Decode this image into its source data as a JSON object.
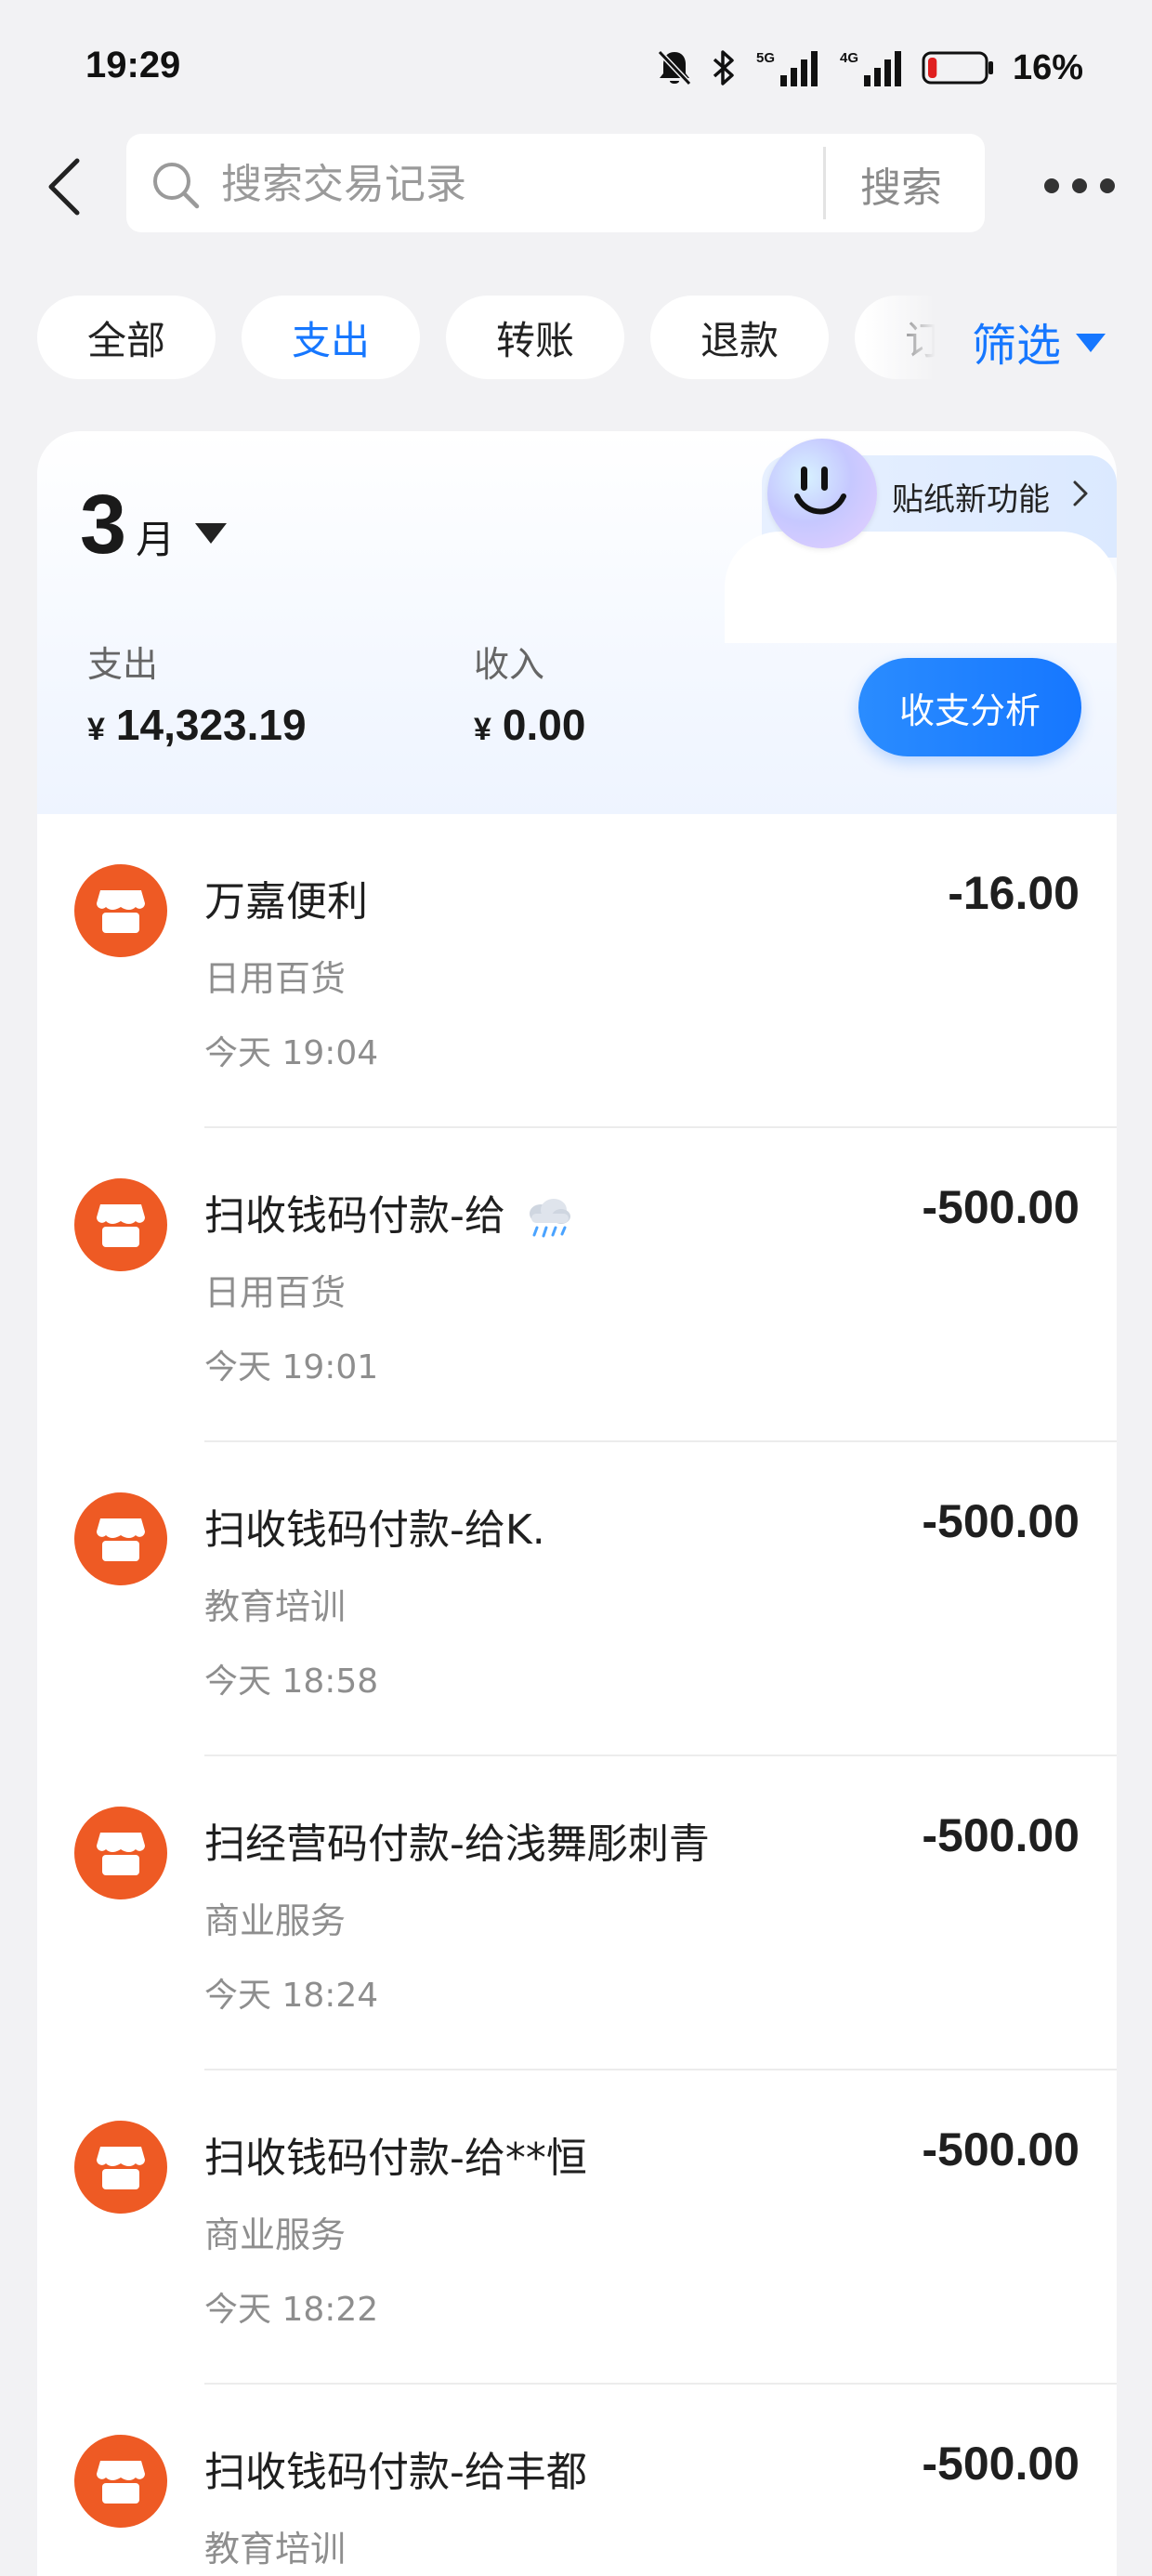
{
  "status_bar": {
    "time": "19:29",
    "battery_percent": "16%",
    "battery_level": 0.16,
    "network_5g": "5G",
    "network_4g": "4G",
    "icons": [
      "mute-bell-icon",
      "bluetooth-icon",
      "signal-5g-icon",
      "signal-4g-icon",
      "battery-icon"
    ]
  },
  "header": {
    "search_placeholder": "搜索交易记录",
    "search_value": "",
    "search_button_label": "搜索",
    "back_icon": "chevron-left-icon",
    "more_icon": "more-dots-icon"
  },
  "filters": {
    "chips": [
      {
        "label": "全部",
        "active": false
      },
      {
        "label": "支出",
        "active": true
      },
      {
        "label": "转账",
        "active": false
      },
      {
        "label": "退款",
        "active": false
      },
      {
        "label": "订单",
        "active": false
      }
    ],
    "filter_label": "筛选",
    "colors": {
      "active": "#1677ff"
    }
  },
  "summary": {
    "month_number": "3",
    "month_unit": "月",
    "sticker_label": "贴纸新功能",
    "expense_label": "支出",
    "expense_currency": "¥",
    "expense_value": "14,323.19",
    "income_label": "收入",
    "income_currency": "¥",
    "income_value": "0.00",
    "analysis_button_label": "收支分析"
  },
  "transactions": [
    {
      "title": "万嘉便利",
      "category": "日用百货",
      "time": "今天 19:04",
      "amount": "-16.00",
      "icon": "shop-icon"
    },
    {
      "title": "扫收钱码付款-给",
      "title_suffix_icon": "rain-cloud-icon",
      "category": "日用百货",
      "time": "今天 19:01",
      "amount": "-500.00",
      "icon": "shop-icon"
    },
    {
      "title": "扫收钱码付款-给K.",
      "category": "教育培训",
      "time": "今天 18:58",
      "amount": "-500.00",
      "icon": "shop-icon"
    },
    {
      "title": "扫经营码付款-给浅舞彫刺青",
      "category": "商业服务",
      "time": "今天 18:24",
      "amount": "-500.00",
      "icon": "shop-icon"
    },
    {
      "title": "扫收钱码付款-给**恒",
      "category": "商业服务",
      "time": "今天 18:22",
      "amount": "-500.00",
      "icon": "shop-icon"
    },
    {
      "title": "扫收钱码付款-给丰都",
      "category": "教育培训",
      "time": "",
      "amount": "-500.00",
      "icon": "shop-icon"
    }
  ],
  "colors": {
    "background": "#f2f2f4",
    "accent": "#1677ff",
    "shop_icon": "#ee5a24"
  }
}
